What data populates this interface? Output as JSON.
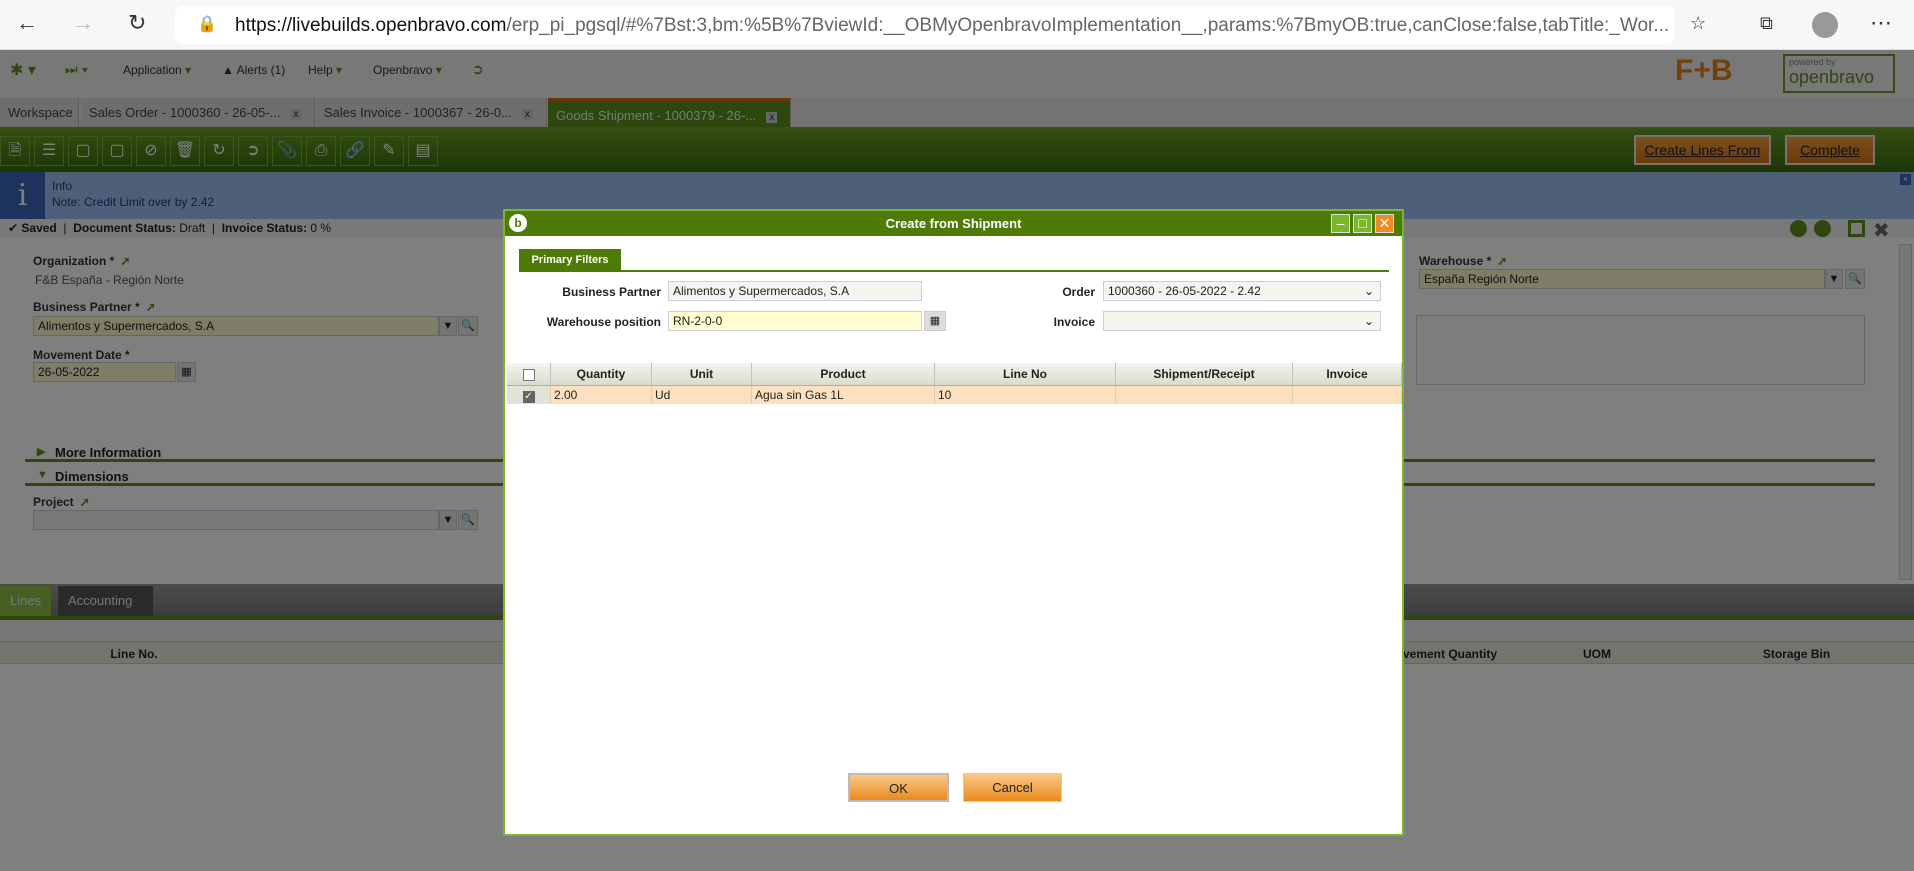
{
  "browser": {
    "url_host": "https://livebuilds.openbravo.com",
    "url_rest": "/erp_pi_pgsql/#%7Bst:3,bm:%5B%7BviewId:__OBMyOpenbravoImplementation__,params:%7BmyOB:true,canClose:false,tabTitle:_Wor..."
  },
  "menu": {
    "application": "Application",
    "alerts": "Alerts (1)",
    "help": "Help",
    "openbravo": "Openbravo"
  },
  "logos": {
    "fb": "F+B",
    "openbravo": "openbravo",
    "powered": "powered by"
  },
  "tabs": [
    {
      "label": "Workspace"
    },
    {
      "label": "Sales Order - 1000360 - 26-05-..."
    },
    {
      "label": "Sales Invoice - 1000367 - 26-0..."
    },
    {
      "label": "Goods Shipment - 1000379 - 26-..."
    }
  ],
  "close_x": "x",
  "actions": {
    "create_lines": "Create Lines From",
    "complete": "Complete"
  },
  "info": {
    "title": "Info",
    "message": "Note: Credit Limit over by 2.42"
  },
  "status": {
    "saved": "Saved",
    "doc_label": "Document Status:",
    "doc_value": "Draft",
    "inv_label": "Invoice Status:",
    "inv_value": "0 %"
  },
  "form": {
    "organization_label": "Organization *",
    "organization_value": "F&B España - Región Norte",
    "bp_label": "Business Partner *",
    "bp_value": "Alimentos y Supermercados, S.A",
    "date_label": "Movement Date *",
    "date_value": "26-05-2022",
    "warehouse_label": "Warehouse *",
    "warehouse_value": "España Región Norte",
    "more_info": "More Information",
    "dimensions": "Dimensions",
    "project_label": "Project"
  },
  "lines": {
    "tabs": [
      "Lines",
      "Accounting"
    ],
    "headers": {
      "line_no": "Line No.",
      "movement_qty": "Movement Quantity",
      "uom": "UOM",
      "storage_bin": "Storage Bin"
    }
  },
  "dialog": {
    "title": "Create from Shipment",
    "tab": "Primary Filters",
    "bp_label": "Business Partner",
    "bp_value": "Alimentos y Supermercados, S.A",
    "wp_label": "Warehouse position",
    "wp_value": "RN-2-0-0",
    "order_label": "Order",
    "order_value": "1000360 - 26-05-2022 - 2.42",
    "invoice_label": "Invoice",
    "invoice_value": "",
    "columns": [
      "Quantity",
      "Unit",
      "Product",
      "Line No",
      "Shipment/Receipt",
      "Invoice"
    ],
    "rows": [
      {
        "selected": true,
        "cells": [
          "2.00",
          "Ud",
          "Agua sin Gas 1L",
          "10",
          "",
          ""
        ]
      }
    ],
    "ok": "OK",
    "cancel": "Cancel"
  }
}
